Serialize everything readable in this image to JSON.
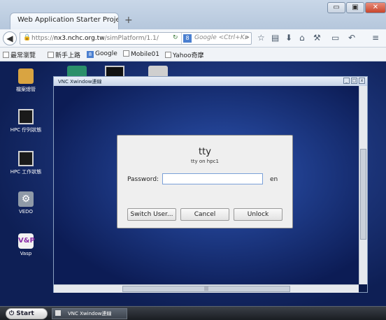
{
  "browser": {
    "tab_title": "Web Application Starter Project",
    "new_tab": "+",
    "window_controls": {
      "minimize": "▭",
      "maximize": "▣",
      "close": "✕"
    },
    "url_prefix": "https://",
    "url_domain": "nx3.nchc.org.tw",
    "url_path": "/simPlatform/1.1/",
    "search_placeholder": "Google <Ctrl+K>",
    "search_engine": "8"
  },
  "bookmarks": [
    {
      "label": "最常瀏覽",
      "icon": "bookmark-icon"
    },
    {
      "label": "新手上路",
      "icon": "page-icon"
    },
    {
      "label": "Google",
      "icon": "google-icon"
    },
    {
      "label": "Mobile01",
      "icon": "page-icon"
    },
    {
      "label": "Yahoo奇摩",
      "icon": "page-icon"
    }
  ],
  "desktop_icons": [
    {
      "label": "檔案總管"
    },
    {
      "label": "HPC 佇列狀態"
    },
    {
      "label": "HPC 工作狀態"
    },
    {
      "label": "VEDO"
    },
    {
      "label": "Vasp"
    }
  ],
  "vnc_window": {
    "title": "VNC Xwindow連線",
    "hscroll_grip": "|||"
  },
  "dialog": {
    "title": "tty",
    "subtitle": "tty on hpc1",
    "password_label": "Password:",
    "password_value": "",
    "lang": "en",
    "switch_user": "Switch User...",
    "cancel": "Cancel",
    "unlock": "Unlock"
  },
  "taskbar": {
    "start": "Start",
    "task": "VNC Xwindow連線"
  }
}
